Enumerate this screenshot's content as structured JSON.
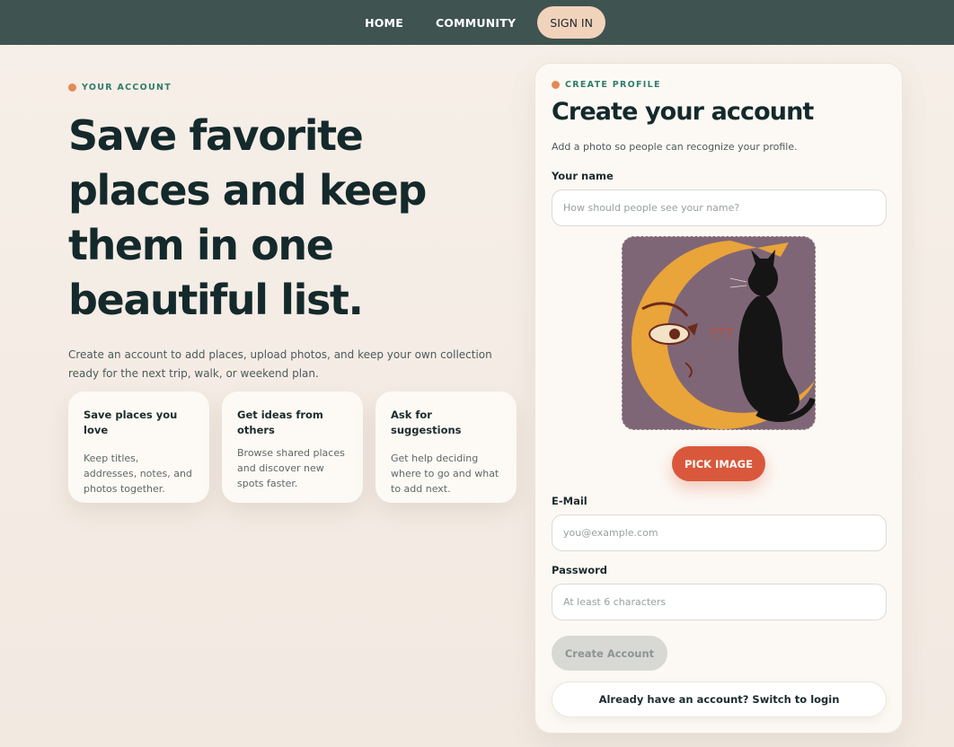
{
  "nav": {
    "home": "HOME",
    "community": "COMMUNITY",
    "sign_in": "SIGN IN"
  },
  "hero": {
    "eyebrow": "YOUR ACCOUNT",
    "title": "Save favorite places and keep them in one beautiful list.",
    "description": "Create an account to add places, upload photos, and keep your own collection ready for the next trip, walk, or weekend plan."
  },
  "features": [
    {
      "title": "Save places you love",
      "body": "Keep titles, addresses, notes, and photos together."
    },
    {
      "title": "Get ideas from others",
      "body": "Browse shared places and discover new spots faster."
    },
    {
      "title": "Ask for suggestions",
      "body": "Get help deciding where to go and what to add next."
    }
  ],
  "form": {
    "eyebrow": "CREATE PROFILE",
    "title": "Create your account",
    "subtitle": "Add a photo so people can recognize your profile.",
    "name_label": "Your name",
    "name_placeholder": "How should people see your name?",
    "name_value": "",
    "pick_image": "PICK IMAGE",
    "email_label": "E-Mail",
    "email_placeholder": "you@example.com",
    "email_value": "",
    "password_label": "Password",
    "password_placeholder": "At least 6 characters",
    "password_value": "",
    "create_button": "Create Account",
    "switch_button": "Already have an account? Switch to login"
  },
  "colors": {
    "topbar": "#3f5350",
    "accent_dot": "#e38a56",
    "eyebrow_text": "#2e7d6b",
    "primary_button": "#d9583b",
    "disabled_button": "#d8d9d4",
    "sign_in_pill": "#f1d3bc"
  }
}
